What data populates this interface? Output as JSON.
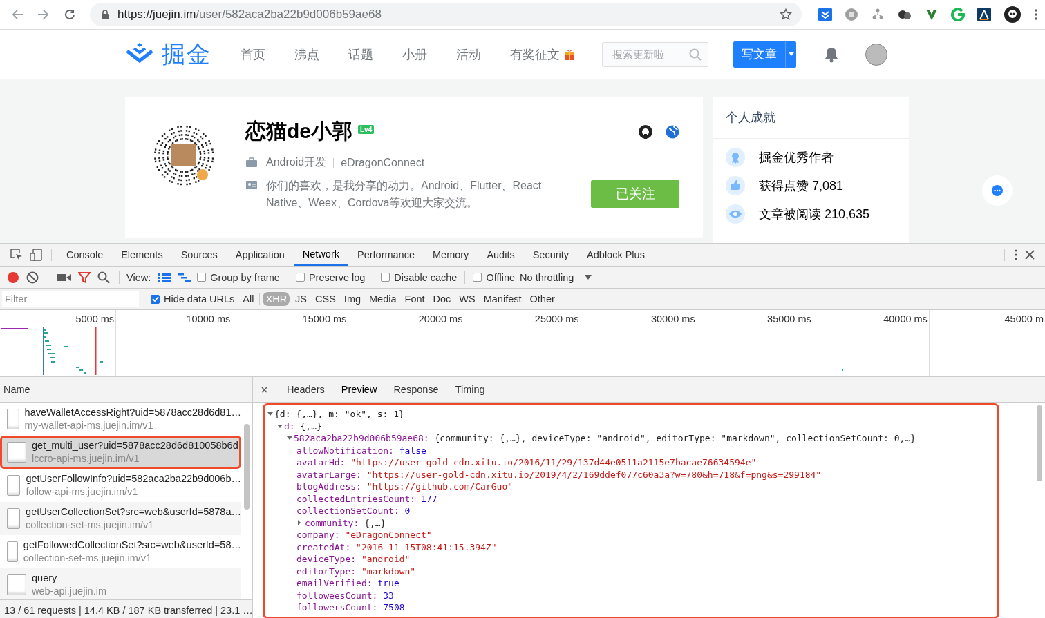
{
  "browser": {
    "url_host": "https://juejin.im",
    "url_path": "/user/582aca2ba22b9d006b59ae68"
  },
  "site_header": {
    "logo_text": "掘金",
    "nav": [
      {
        "label": "首页",
        "gift": false
      },
      {
        "label": "沸点",
        "gift": false
      },
      {
        "label": "话题",
        "gift": false
      },
      {
        "label": "小册",
        "gift": false
      },
      {
        "label": "活动",
        "gift": false
      },
      {
        "label": "有奖征文",
        "gift": true
      }
    ],
    "search_placeholder": "搜索更新啦",
    "write_button": "写文章"
  },
  "profile": {
    "name": "恋猫de小郭",
    "level": "Lv4",
    "job": "Android开发",
    "company": "eDragonConnect",
    "bio": "你们的喜欢，是我分享的动力。Android、Flutter、React Native、Weex、Cordova等欢迎大家交流。",
    "follow_button": "已关注",
    "followed": true
  },
  "achievements": {
    "title": "个人成就",
    "items": [
      {
        "kind": "medal",
        "text": "掘金优秀作者"
      },
      {
        "kind": "like",
        "text": "获得点赞 7,081"
      },
      {
        "kind": "eye",
        "text": "文章被阅读 210,635"
      }
    ]
  },
  "devtools": {
    "tabs": [
      {
        "label": "Console",
        "selected": false
      },
      {
        "label": "Elements",
        "selected": false
      },
      {
        "label": "Sources",
        "selected": false
      },
      {
        "label": "Application",
        "selected": false
      },
      {
        "label": "Network",
        "selected": true
      },
      {
        "label": "Performance",
        "selected": false
      },
      {
        "label": "Memory",
        "selected": false
      },
      {
        "label": "Audits",
        "selected": false
      },
      {
        "label": "Security",
        "selected": false
      },
      {
        "label": "Adblock Plus",
        "selected": false
      }
    ],
    "toolbar": {
      "recording": true,
      "view_label": "View:",
      "options": [
        {
          "label": "Group by frame",
          "checked": false
        },
        {
          "label": "Preserve log",
          "checked": false
        },
        {
          "label": "Disable cache",
          "checked": false
        },
        {
          "label": "Offline",
          "checked": false
        }
      ],
      "throttling": "No throttling"
    },
    "filter": {
      "placeholder": "Filter",
      "hide_data_urls": {
        "label": "Hide data URLs",
        "checked": true
      },
      "types": [
        {
          "label": "All",
          "selected": false
        },
        {
          "label": "XHR",
          "selected": true
        },
        {
          "label": "JS",
          "selected": false
        },
        {
          "label": "CSS",
          "selected": false
        },
        {
          "label": "Img",
          "selected": false
        },
        {
          "label": "Media",
          "selected": false
        },
        {
          "label": "Font",
          "selected": false
        },
        {
          "label": "Doc",
          "selected": false
        },
        {
          "label": "WS",
          "selected": false
        },
        {
          "label": "Manifest",
          "selected": false
        },
        {
          "label": "Other",
          "selected": false
        }
      ]
    },
    "timeline_ticks": [
      "5000 ms",
      "10000 ms",
      "15000 ms",
      "20000 ms",
      "25000 ms",
      "30000 ms",
      "35000 ms",
      "40000 ms",
      "45000 m"
    ],
    "name_header": "Name",
    "requests": [
      {
        "name": "haveWalletAccessRight?uid=5878acc28d6d81…",
        "host": "my-wallet-api-ms.juejin.im/v1",
        "selected": false,
        "annotated": false
      },
      {
        "name": "get_multi_user?uid=5878acc28d6d810058b6d",
        "host": "lccro-api-ms.juejin.im/v1",
        "selected": true,
        "annotated": true
      },
      {
        "name": "getUserFollowInfo?uid=582aca2ba22b9d006b…",
        "host": "follow-api-ms.juejin.im/v1",
        "selected": false,
        "annotated": false
      },
      {
        "name": "getUserCollectionSet?src=web&userId=5878a…",
        "host": "collection-set-ms.juejin.im/v1",
        "selected": false,
        "annotated": false
      },
      {
        "name": "getFollowedCollectionSet?src=web&userId=58…",
        "host": "collection-set-ms.juejin.im/v1",
        "selected": false,
        "annotated": false
      },
      {
        "name": "query",
        "host": "web-api.juejin.im",
        "selected": false,
        "annotated": false
      }
    ],
    "status": "13 / 61 requests | 14.4 KB / 187 KB transferred | 23.1 …",
    "detail_tabs": [
      {
        "label": "Headers",
        "selected": false
      },
      {
        "label": "Preview",
        "selected": true
      },
      {
        "label": "Response",
        "selected": false
      },
      {
        "label": "Timing",
        "selected": false
      }
    ],
    "preview": {
      "annotated": true,
      "tree": [
        {
          "summary": "{d: {,…}, m: \"ok\", s: 1}",
          "expanded": true,
          "children": [
            {
              "key": "d:",
              "summary": "{,…}",
              "expanded": true,
              "children": [
                {
                  "key": "582aca2ba22b9d006b59ae68:",
                  "summary": "{community: {,…}, deviceType: \"android\", editorType: \"markdown\", collectionSetCount: 0,…}",
                  "expanded": true,
                  "children": [
                    {
                      "key": "allowNotification:",
                      "kind": "boolean",
                      "value": "false"
                    },
                    {
                      "key": "avatarHd:",
                      "kind": "string",
                      "value": "\"https://user-gold-cdn.xitu.io/2016/11/29/137d44e0511a2115e7bacae76634594e\""
                    },
                    {
                      "key": "avatarLarge:",
                      "kind": "string",
                      "value": "\"https://user-gold-cdn.xitu.io/2019/4/2/169ddef077c60a3a?w=780&h=718&f=png&s=299184\""
                    },
                    {
                      "key": "blogAddress:",
                      "kind": "string",
                      "value": "\"https://github.com/CarGuo\""
                    },
                    {
                      "key": "collectedEntriesCount:",
                      "kind": "number",
                      "value": "177"
                    },
                    {
                      "key": "collectionSetCount:",
                      "kind": "number",
                      "value": "0"
                    },
                    {
                      "key": "community:",
                      "summary": "{,…}",
                      "expanded": false
                    },
                    {
                      "key": "company:",
                      "kind": "string",
                      "value": "\"eDragonConnect\""
                    },
                    {
                      "key": "createdAt:",
                      "kind": "string",
                      "value": "\"2016-11-15T08:41:15.394Z\""
                    },
                    {
                      "key": "deviceType:",
                      "kind": "string",
                      "value": "\"android\""
                    },
                    {
                      "key": "editorType:",
                      "kind": "string",
                      "value": "\"markdown\""
                    },
                    {
                      "key": "emailVerified:",
                      "kind": "boolean",
                      "value": "true"
                    },
                    {
                      "key": "followeesCount:",
                      "kind": "number",
                      "value": "33"
                    },
                    {
                      "key": "followersCount:",
                      "kind": "number",
                      "value": "7508"
                    }
                  ]
                }
              ]
            }
          ]
        }
      ]
    }
  }
}
